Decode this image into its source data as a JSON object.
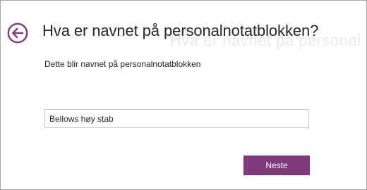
{
  "icons": {
    "back": "arrow-left-circle-icon"
  },
  "colors": {
    "accent": "#80397b",
    "text": "#262626",
    "field_border": "#c8c8c8",
    "frame_border": "#a6a6a6"
  },
  "dialog": {
    "title": "Hva er navnet på personalnotatblokken?",
    "subtitle": "Dette blir navnet på personalnotatblokken",
    "name_field": {
      "value": "Bellows høy stab"
    },
    "next_label": "Neste"
  }
}
